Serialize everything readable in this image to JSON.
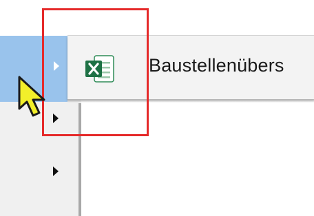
{
  "flyout": {
    "item_label": "Baustellenübers",
    "item_icon": "excel-file-icon"
  },
  "menu": {
    "arrows": [
      "submenu-arrow",
      "submenu-arrow",
      "submenu-arrow"
    ]
  },
  "overlay": {
    "highlight_box_color": "#e52a2a",
    "cursor": "yellow-arrow-cursor"
  },
  "colors": {
    "selection": "#99c3ec",
    "excel_green": "#1e7145"
  }
}
